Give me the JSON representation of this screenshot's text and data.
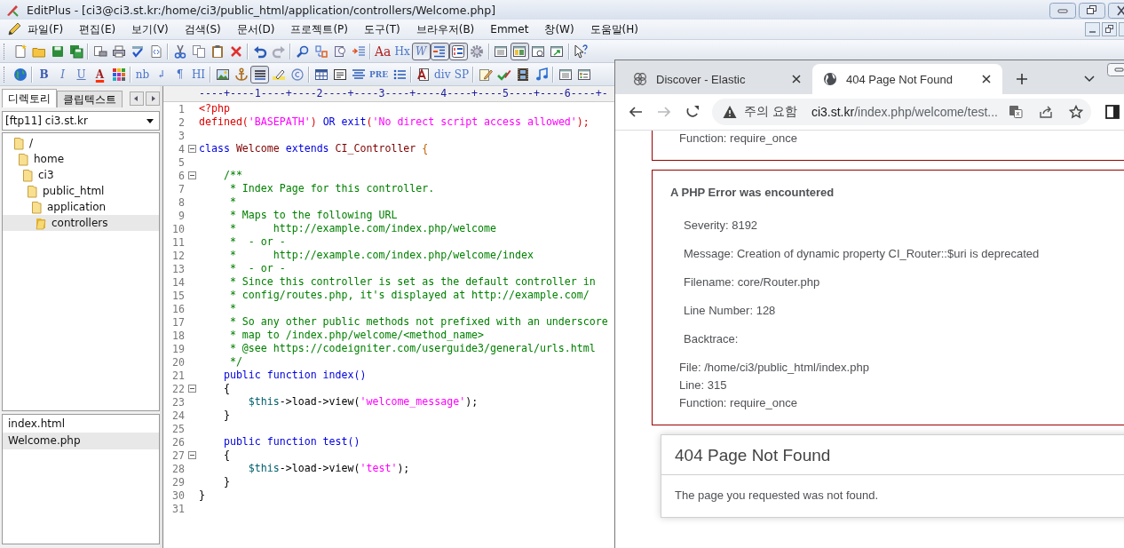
{
  "editplus": {
    "title": "EditPlus - [ci3@ci3.st.kr:/home/ci3/public_html/application/controllers/Welcome.php]",
    "menu": [
      "파일(F)",
      "편집(E)",
      "보기(V)",
      "검색(S)",
      "문서(D)",
      "프로젝트(P)",
      "도구(T)",
      "브라우저(B)",
      "Emmet",
      "창(W)",
      "도움말(H)"
    ],
    "toolbars": [
      [
        {
          "kind": "icon",
          "pressed": false
        },
        {
          "kind": "icon",
          "pressed": false
        },
        {
          "kind": "icon",
          "pressed": false
        },
        {
          "kind": "icon",
          "pressed": false
        },
        {
          "kind": "separator"
        },
        {
          "kind": "icon",
          "pressed": false
        },
        {
          "kind": "icon",
          "pressed": false
        },
        {
          "kind": "icon",
          "pressed": false
        },
        {
          "kind": "icon",
          "pressed": false
        },
        {
          "kind": "separator"
        },
        {
          "kind": "icon",
          "pressed": false
        },
        {
          "kind": "icon",
          "pressed": false
        },
        {
          "kind": "icon",
          "pressed": false
        },
        {
          "kind": "icon",
          "pressed": false
        },
        {
          "kind": "separator"
        },
        {
          "kind": "icon",
          "pressed": false
        },
        {
          "kind": "icon",
          "pressed": false
        },
        {
          "kind": "separator"
        },
        {
          "kind": "icon",
          "pressed": false
        },
        {
          "kind": "icon",
          "pressed": false
        },
        {
          "kind": "icon",
          "pressed": false
        },
        {
          "kind": "icon",
          "pressed": false
        },
        {
          "kind": "separator"
        },
        {
          "kind": "text",
          "label": "Aa",
          "pressed": false
        },
        {
          "kind": "text",
          "label": "Hx",
          "pressed": false
        },
        {
          "kind": "text",
          "label": "W",
          "pressed": true
        },
        {
          "kind": "icon",
          "pressed": true
        },
        {
          "kind": "icon",
          "pressed": true
        },
        {
          "kind": "icon",
          "pressed": false
        },
        {
          "kind": "separator"
        },
        {
          "kind": "icon",
          "pressed": false
        },
        {
          "kind": "icon",
          "pressed": true
        },
        {
          "kind": "icon",
          "pressed": false
        },
        {
          "kind": "icon",
          "pressed": false
        },
        {
          "kind": "separator"
        },
        {
          "kind": "icon",
          "pressed": false
        }
      ],
      [
        {
          "kind": "icon",
          "pressed": false
        },
        {
          "kind": "separator"
        },
        {
          "kind": "text",
          "label": "B",
          "pressed": false
        },
        {
          "kind": "text",
          "label": "I",
          "pressed": false
        },
        {
          "kind": "text",
          "label": "U",
          "pressed": false
        },
        {
          "kind": "text",
          "label": "A",
          "pressed": false
        },
        {
          "kind": "icon",
          "pressed": false
        },
        {
          "kind": "separator"
        },
        {
          "kind": "text",
          "label": "nb",
          "pressed": false
        },
        {
          "kind": "text",
          "label": "↲",
          "pressed": false
        },
        {
          "kind": "text",
          "label": "¶",
          "pressed": false
        },
        {
          "kind": "text",
          "label": "HI",
          "pressed": false
        },
        {
          "kind": "separator"
        },
        {
          "kind": "icon",
          "pressed": false
        },
        {
          "kind": "icon",
          "pressed": false
        },
        {
          "kind": "icon",
          "pressed": true
        },
        {
          "kind": "icon",
          "pressed": false
        },
        {
          "kind": "icon",
          "pressed": false
        },
        {
          "kind": "separator"
        },
        {
          "kind": "icon",
          "pressed": false
        },
        {
          "kind": "icon",
          "pressed": false
        },
        {
          "kind": "icon",
          "pressed": false
        },
        {
          "kind": "text",
          "label": "PRE",
          "pressed": false
        },
        {
          "kind": "icon",
          "pressed": false
        },
        {
          "kind": "separator"
        },
        {
          "kind": "icon",
          "pressed": false
        },
        {
          "kind": "text",
          "label": "div",
          "pressed": false
        },
        {
          "kind": "text",
          "label": "SP",
          "pressed": false
        },
        {
          "kind": "separator"
        },
        {
          "kind": "icon",
          "pressed": false
        },
        {
          "kind": "icon",
          "pressed": false
        },
        {
          "kind": "icon",
          "pressed": false
        },
        {
          "kind": "icon",
          "pressed": false
        },
        {
          "kind": "separator"
        },
        {
          "kind": "icon",
          "pressed": false
        },
        {
          "kind": "icon",
          "pressed": false
        }
      ]
    ],
    "sidebar": {
      "tabs": [
        {
          "label": "디렉토리",
          "selected": true
        },
        {
          "label": "클립텍스트",
          "selected": false
        }
      ],
      "drive": "[ftp11] ci3.st.kr",
      "tree": [
        {
          "label": "/",
          "selected": false,
          "children": [
            {
              "label": "home",
              "selected": false,
              "children": [
                {
                  "label": "ci3",
                  "selected": false,
                  "children": [
                    {
                      "label": "public_html",
                      "selected": false,
                      "children": [
                        {
                          "label": "application",
                          "selected": false,
                          "children": [
                            {
                              "label": "controllers",
                              "selected": true
                            }
                          ]
                        }
                      ]
                    }
                  ]
                }
              ]
            }
          ]
        }
      ],
      "files": [
        {
          "label": "index.html",
          "selected": false
        },
        {
          "label": "Welcome.php",
          "selected": true
        }
      ]
    },
    "editor": {
      "ruler": "----+----1----+----2----+----3----+----4----+----5----+----6----+-",
      "lines": [
        {
          "number": "1",
          "fold": false,
          "tokens": [
            {
              "kind": "tag",
              "text": "<?php"
            }
          ]
        },
        {
          "number": "2",
          "fold": false,
          "tokens": [
            {
              "kind": "tag",
              "text": "defined("
            },
            {
              "kind": "string",
              "text": "'BASEPATH'"
            },
            {
              "kind": "tag",
              "text": ") "
            },
            {
              "kind": "keyword",
              "text": "OR exit"
            },
            {
              "kind": "tag",
              "text": "("
            },
            {
              "kind": "string",
              "text": "'No direct script access allowed'"
            },
            {
              "kind": "tag",
              "text": ");"
            }
          ]
        },
        {
          "number": "3",
          "fold": false
        },
        {
          "number": "4",
          "fold": true,
          "tokens": [
            {
              "kind": "keyword",
              "text": "class "
            },
            {
              "kind": "name",
              "text": "Welcome "
            },
            {
              "kind": "keyword",
              "text": "extends "
            },
            {
              "kind": "name",
              "text": "CI_Controller "
            },
            {
              "kind": "brace",
              "text": "{"
            }
          ]
        },
        {
          "number": "5",
          "fold": false
        },
        {
          "number": "6",
          "fold": true,
          "tokens": [
            {
              "kind": "comment",
              "text": "    /**"
            }
          ]
        },
        {
          "number": "7",
          "fold": false,
          "tokens": [
            {
              "kind": "comment",
              "text": "     * Index Page for this controller."
            }
          ]
        },
        {
          "number": "8",
          "fold": false,
          "tokens": [
            {
              "kind": "comment",
              "text": "     *"
            }
          ]
        },
        {
          "number": "9",
          "fold": false,
          "tokens": [
            {
              "kind": "comment",
              "text": "     * Maps to the following URL"
            }
          ]
        },
        {
          "number": "10",
          "fold": false,
          "tokens": [
            {
              "kind": "comment",
              "text": "     *      http://example.com/index.php/welcome"
            }
          ]
        },
        {
          "number": "11",
          "fold": false,
          "tokens": [
            {
              "kind": "comment",
              "text": "     *  - or -"
            }
          ]
        },
        {
          "number": "12",
          "fold": false,
          "tokens": [
            {
              "kind": "comment",
              "text": "     *      http://example.com/index.php/welcome/index"
            }
          ]
        },
        {
          "number": "13",
          "fold": false,
          "tokens": [
            {
              "kind": "comment",
              "text": "     *  - or -"
            }
          ]
        },
        {
          "number": "14",
          "fold": false,
          "tokens": [
            {
              "kind": "comment",
              "text": "     * Since this controller is set as the default controller in"
            }
          ]
        },
        {
          "number": "15",
          "fold": false,
          "tokens": [
            {
              "kind": "comment",
              "text": "     * config/routes.php, it's displayed at http://example.com/"
            }
          ]
        },
        {
          "number": "16",
          "fold": false,
          "tokens": [
            {
              "kind": "comment",
              "text": "     *"
            }
          ]
        },
        {
          "number": "17",
          "fold": false,
          "tokens": [
            {
              "kind": "comment",
              "text": "     * So any other public methods not prefixed with an underscore"
            }
          ]
        },
        {
          "number": "18",
          "fold": false,
          "tokens": [
            {
              "kind": "comment",
              "text": "     * map to /index.php/welcome/<method_name>"
            }
          ]
        },
        {
          "number": "19",
          "fold": false,
          "tokens": [
            {
              "kind": "comment",
              "text": "     * @see https://codeigniter.com/userguide3/general/urls.html"
            }
          ]
        },
        {
          "number": "20",
          "fold": false,
          "tokens": [
            {
              "kind": "comment",
              "text": "     */"
            }
          ]
        },
        {
          "number": "21",
          "fold": false,
          "tokens": [
            {
              "kind": "keyword",
              "text": "    public function index()"
            }
          ]
        },
        {
          "number": "22",
          "fold": true,
          "tokens": [
            {
              "kind": "plain",
              "text": "    {"
            }
          ]
        },
        {
          "number": "23",
          "fold": false,
          "tokens": [
            {
              "kind": "var",
              "text": "        $this"
            },
            {
              "kind": "plain",
              "text": "->load->view("
            },
            {
              "kind": "string",
              "text": "'welcome_message'"
            },
            {
              "kind": "plain",
              "text": ");"
            }
          ]
        },
        {
          "number": "24",
          "fold": false,
          "tokens": [
            {
              "kind": "plain",
              "text": "    }"
            }
          ]
        },
        {
          "number": "25",
          "fold": false
        },
        {
          "number": "26",
          "fold": false,
          "tokens": [
            {
              "kind": "keyword",
              "text": "    public function test()"
            }
          ]
        },
        {
          "number": "27",
          "fold": true,
          "tokens": [
            {
              "kind": "plain",
              "text": "    {"
            }
          ]
        },
        {
          "number": "28",
          "fold": false,
          "tokens": [
            {
              "kind": "var",
              "text": "        $this"
            },
            {
              "kind": "plain",
              "text": "->load->view("
            },
            {
              "kind": "string",
              "text": "'test'"
            },
            {
              "kind": "plain",
              "text": ");"
            }
          ]
        },
        {
          "number": "29",
          "fold": false,
          "tokens": [
            {
              "kind": "plain",
              "text": "    }"
            }
          ]
        },
        {
          "number": "30",
          "fold": false,
          "tokens": [
            {
              "kind": "plain",
              "text": "}"
            }
          ]
        },
        {
          "number": "31",
          "fold": false
        }
      ]
    }
  },
  "browser": {
    "tabs": [
      {
        "title": "Discover - Elastic",
        "selected": false
      },
      {
        "title": "404 Page Not Found",
        "selected": true
      }
    ],
    "forward_enabled": false,
    "address": {
      "warning": "주의 요함",
      "host": "ci3.st.kr",
      "path": "/index.php/welcome/test..."
    },
    "page": {
      "previous_error": {
        "trace": [
          "Function: require_once"
        ]
      },
      "error": {
        "heading": "A PHP Error was encountered",
        "fields": [
          "Severity: 8192",
          "Message: Creation of dynamic property CI_Router::$uri is deprecated",
          "Filename: core/Router.php",
          "Line Number: 128",
          "Backtrace:"
        ],
        "trace": [
          "File: /home/ci3/public_html/index.php",
          "Line: 315",
          "Function: require_once"
        ]
      },
      "not_found": {
        "heading": "404 Page Not Found",
        "message": "The page you requested was not found."
      }
    }
  }
}
